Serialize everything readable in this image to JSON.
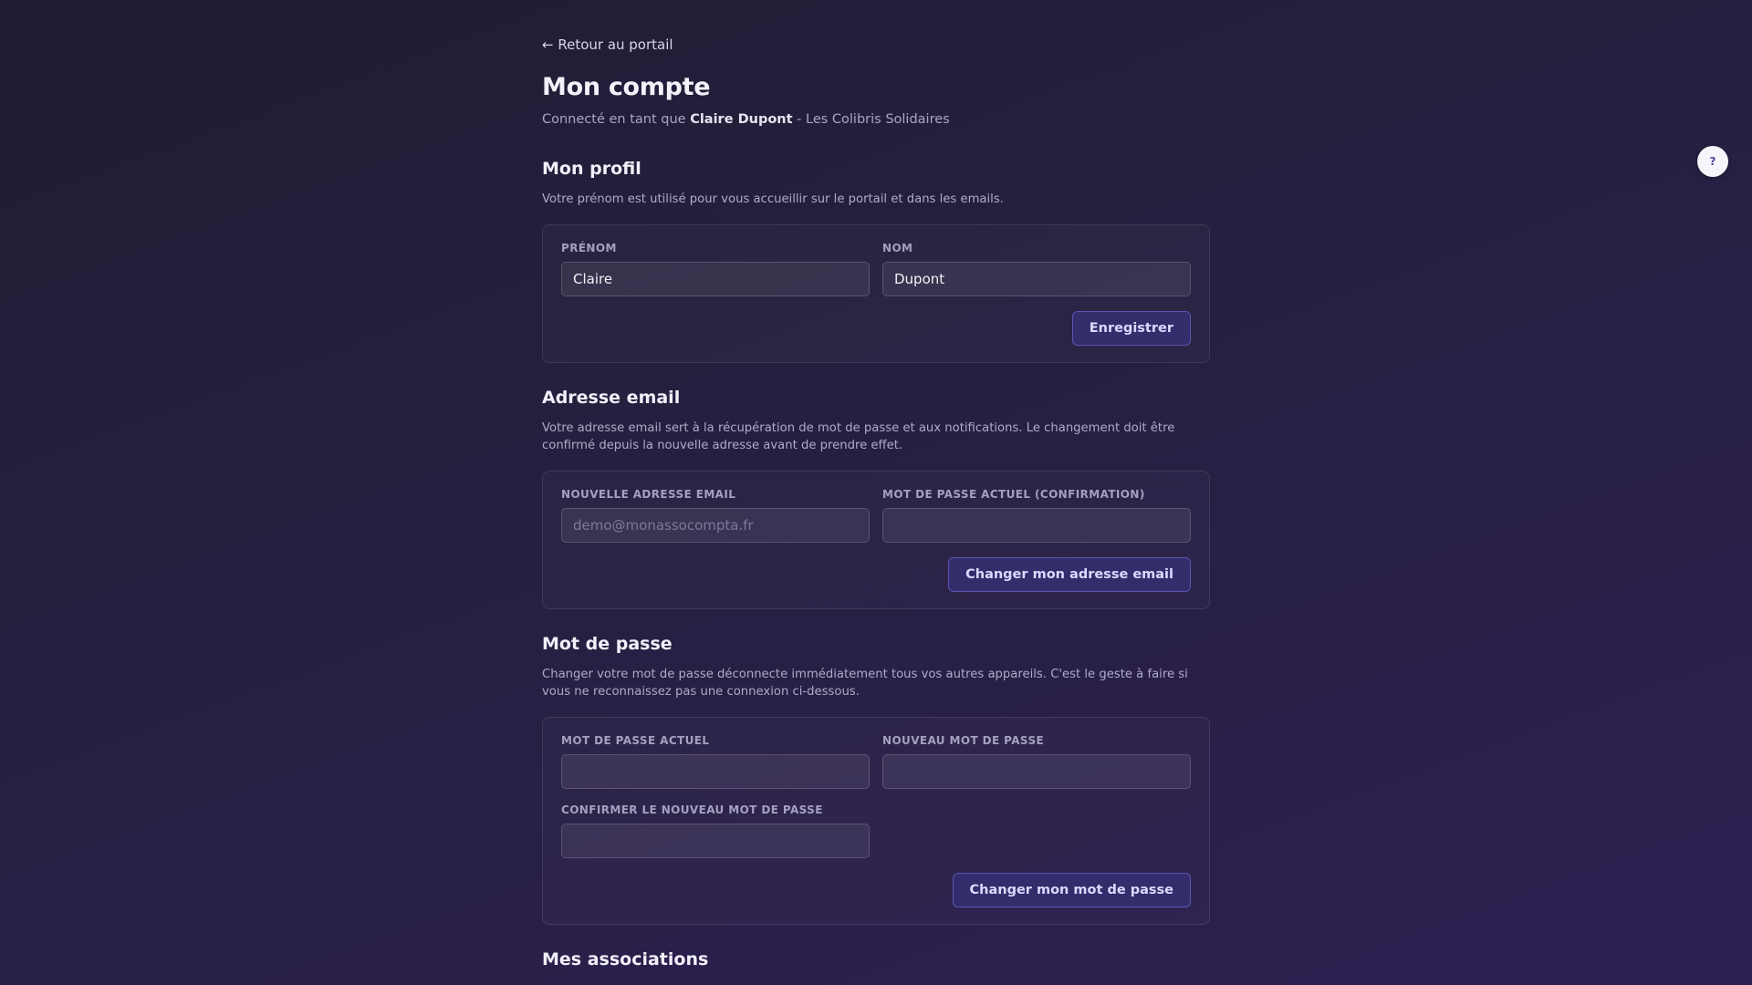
{
  "nav": {
    "back_link": "← Retour au portail"
  },
  "header": {
    "title": "Mon compte",
    "subtitle_prefix": "Connecté en tant que ",
    "user_name": "Claire Dupont",
    "subtitle_suffix": " - Les Colibris Solidaires"
  },
  "profile": {
    "title": "Mon profil",
    "description": "Votre prénom est utilisé pour vous accueillir sur le portail et dans les emails.",
    "first_name_label": "PRÉNOM",
    "first_name_value": "Claire",
    "last_name_label": "NOM",
    "last_name_value": "Dupont",
    "save_label": "Enregistrer"
  },
  "email": {
    "title": "Adresse email",
    "description": "Votre adresse email sert à la récupération de mot de passe et aux notifications. Le changement doit être confirmé depuis la nouvelle adresse avant de prendre effet.",
    "new_email_label": "NOUVELLE ADRESSE EMAIL",
    "new_email_placeholder": "demo@monassocompta.fr",
    "current_password_label": "MOT DE PASSE ACTUEL (CONFIRMATION)",
    "submit_label": "Changer mon adresse email"
  },
  "password": {
    "title": "Mot de passe",
    "description": "Changer votre mot de passe déconnecte immédiatement tous vos autres appareils. C'est le geste à faire si vous ne reconnaissez pas une connexion ci-dessous.",
    "current_label": "MOT DE PASSE ACTUEL",
    "new_label": "NOUVEAU MOT DE PASSE",
    "confirm_label": "CONFIRMER LE NOUVEAU MOT DE PASSE",
    "submit_label": "Changer mon mot de passe"
  },
  "associations": {
    "title": "Mes associations"
  },
  "help": {
    "label": "?"
  }
}
